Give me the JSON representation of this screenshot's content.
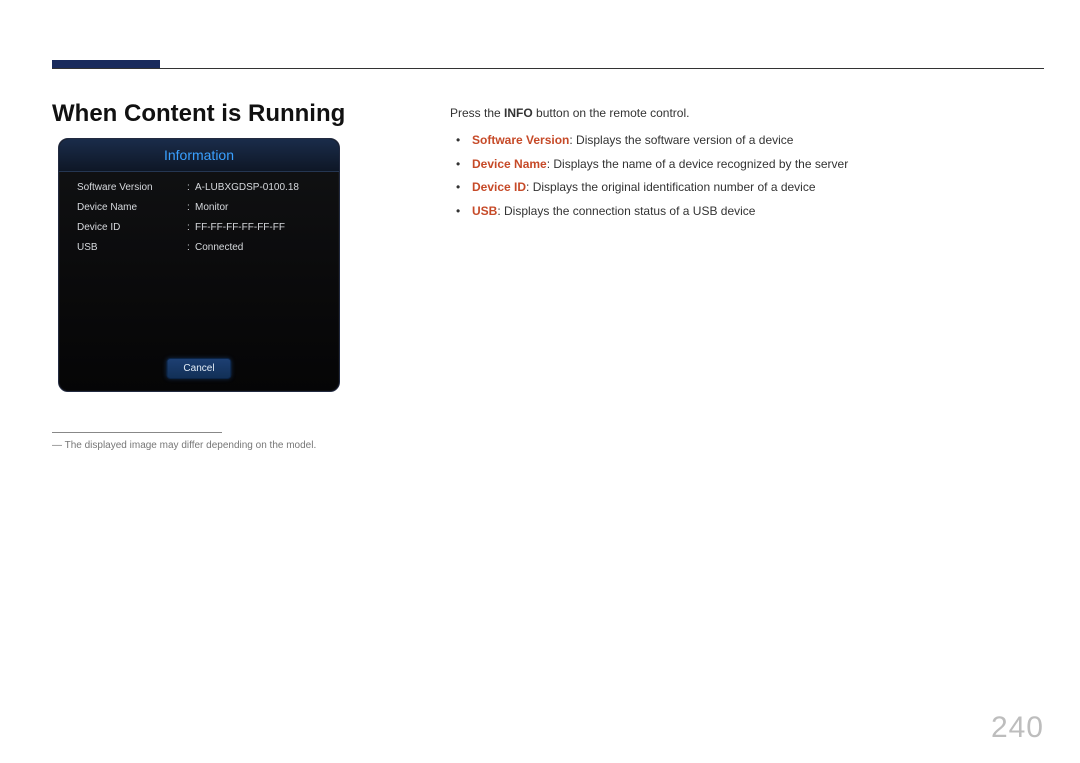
{
  "page": {
    "heading": "When Content is Running",
    "footnote": "― The displayed image may differ depending on the model.",
    "number": "240"
  },
  "dialog": {
    "title": "Information",
    "rows": [
      {
        "label": "Software Version",
        "value": "A-LUBXGDSP-0100.18"
      },
      {
        "label": "Device Name",
        "value": "Monitor"
      },
      {
        "label": "Device ID",
        "value": "FF-FF-FF-FF-FF-FF"
      },
      {
        "label": "USB",
        "value": "Connected"
      }
    ],
    "cancel": "Cancel"
  },
  "instruction": {
    "prefix": "Press the ",
    "bold": "INFO",
    "suffix": " button on the remote control."
  },
  "bullets": [
    {
      "term": "Software Version",
      "desc": ": Displays the software version of a device"
    },
    {
      "term": "Device Name",
      "desc": ": Displays the name of a device recognized by the server"
    },
    {
      "term": "Device ID",
      "desc": ": Displays the original identification number of a device"
    },
    {
      "term": "USB",
      "desc": ": Displays the connection status of a USB device"
    }
  ]
}
